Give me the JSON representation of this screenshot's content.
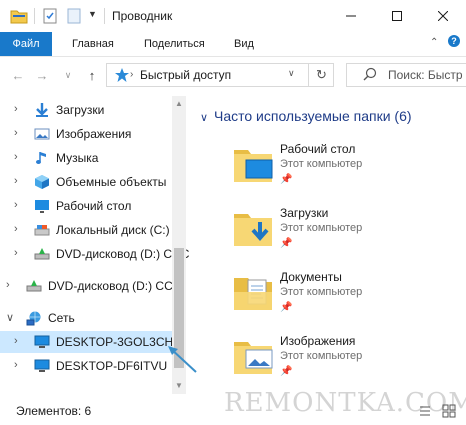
{
  "window": {
    "title": "Проводник",
    "minimize_icon": "minimize-icon",
    "maximize_icon": "maximize-icon",
    "close_icon": "close-icon"
  },
  "ribbon": {
    "file_tab": "Файл",
    "tabs": [
      "Главная",
      "Поделиться",
      "Вид"
    ]
  },
  "address": {
    "path": "Быстрый доступ",
    "search_placeholder": "Поиск: Быстр"
  },
  "nav": {
    "items": [
      {
        "label": "Загрузки",
        "icon": "download-icon"
      },
      {
        "label": "Изображения",
        "icon": "pictures-icon"
      },
      {
        "label": "Музыка",
        "icon": "music-icon"
      },
      {
        "label": "Объемные объекты",
        "icon": "3d-objects-icon"
      },
      {
        "label": "Рабочий стол",
        "icon": "desktop-icon"
      },
      {
        "label": "Локальный диск (C:)",
        "icon": "drive-icon"
      },
      {
        "label": "DVD-дисковод (D:) CCC",
        "icon": "dvd-icon"
      },
      {
        "label": "DVD-дисковод (D:) CCC",
        "icon": "dvd-icon"
      },
      {
        "label": "Сеть",
        "icon": "network-icon"
      },
      {
        "label": "DESKTOP-3GOL3CH",
        "icon": "computer-icon",
        "selected": true
      },
      {
        "label": "DESKTOP-DF6ITVU",
        "icon": "computer-icon"
      }
    ]
  },
  "main": {
    "group_title": "Часто используемые папки (6)",
    "folders": [
      {
        "name": "Рабочий стол",
        "location": "Этот компьютер"
      },
      {
        "name": "Загрузки",
        "location": "Этот компьютер"
      },
      {
        "name": "Документы",
        "location": "Этот компьютер"
      },
      {
        "name": "Изображения",
        "location": "Этот компьютер"
      }
    ]
  },
  "status": {
    "items_count": "Элементов: 6"
  },
  "watermark": "REMONTKA.COM",
  "colors": {
    "accent": "#1979ca",
    "selection": "#cce8ff",
    "folder": "#f7d774",
    "group_title": "#1f3c88"
  }
}
